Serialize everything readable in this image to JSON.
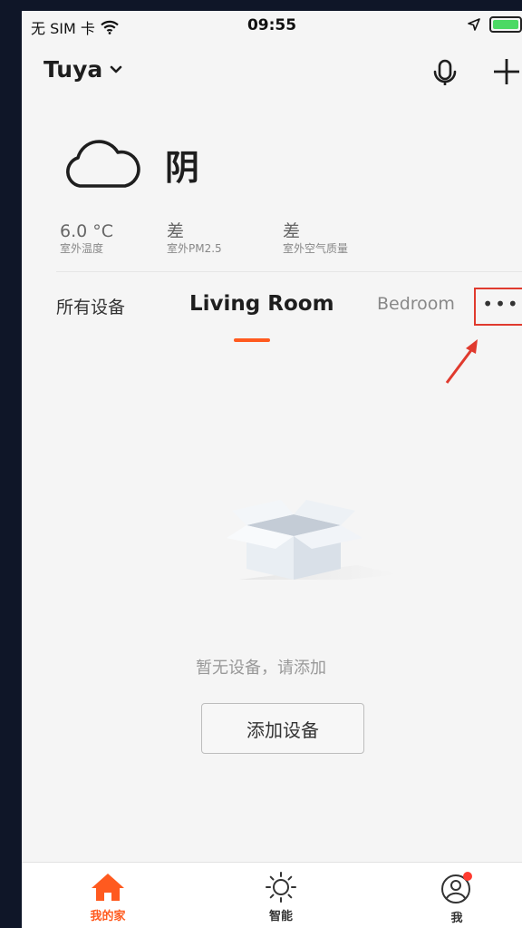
{
  "status_bar": {
    "carrier": "无 SIM 卡",
    "time": "09:55",
    "battery_level": 1.0
  },
  "header": {
    "home_name": "Tuya"
  },
  "weather": {
    "condition": "阴",
    "stats": [
      {
        "value": "6.0 °C",
        "label": "室外温度"
      },
      {
        "value": "差",
        "label": "室外PM2.5"
      },
      {
        "value": "差",
        "label": "室外空气质量"
      }
    ]
  },
  "room_tabs": {
    "items": [
      {
        "label": "所有设备",
        "active": false
      },
      {
        "label": "Living Room",
        "active": true
      },
      {
        "label": "Bedroom",
        "active": false
      }
    ],
    "more_label": "•••",
    "accent_color": "#ff5a1f",
    "highlight_color": "#e03a2e"
  },
  "empty_state": {
    "message": "暂无设备，请添加",
    "button_label": "添加设备"
  },
  "tabbar": {
    "items": [
      {
        "label": "我的家",
        "icon": "home-icon",
        "active": true
      },
      {
        "label": "智能",
        "icon": "sun-icon",
        "active": false
      },
      {
        "label": "我",
        "icon": "user-icon",
        "active": false,
        "badge": true
      }
    ]
  }
}
